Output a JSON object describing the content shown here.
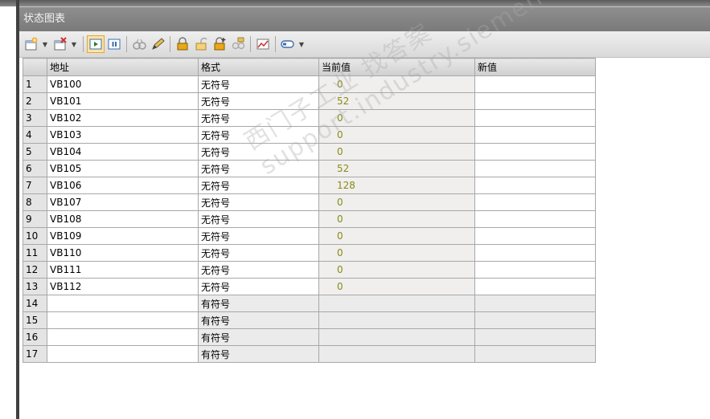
{
  "window": {
    "title": "状态图表"
  },
  "columns": {
    "num": "",
    "address": "地址",
    "format": "格式",
    "current": "当前值",
    "new": "新值"
  },
  "rows": [
    {
      "num": "1",
      "address": "VB100",
      "format": "无符号",
      "current": "0",
      "new": ""
    },
    {
      "num": "2",
      "address": "VB101",
      "format": "无符号",
      "current": "52",
      "new": ""
    },
    {
      "num": "3",
      "address": "VB102",
      "format": "无符号",
      "current": "0",
      "new": ""
    },
    {
      "num": "4",
      "address": "VB103",
      "format": "无符号",
      "current": "0",
      "new": ""
    },
    {
      "num": "5",
      "address": "VB104",
      "format": "无符号",
      "current": "0",
      "new": ""
    },
    {
      "num": "6",
      "address": "VB105",
      "format": "无符号",
      "current": "52",
      "new": ""
    },
    {
      "num": "7",
      "address": "VB106",
      "format": "无符号",
      "current": "128",
      "new": ""
    },
    {
      "num": "8",
      "address": "VB107",
      "format": "无符号",
      "current": "0",
      "new": ""
    },
    {
      "num": "9",
      "address": "VB108",
      "format": "无符号",
      "current": "0",
      "new": ""
    },
    {
      "num": "10",
      "address": "VB109",
      "format": "无符号",
      "current": "0",
      "new": ""
    },
    {
      "num": "11",
      "address": "VB110",
      "format": "无符号",
      "current": "0",
      "new": ""
    },
    {
      "num": "12",
      "address": "VB111",
      "format": "无符号",
      "current": "0",
      "new": ""
    },
    {
      "num": "13",
      "address": "VB112",
      "format": "无符号",
      "current": "0",
      "new": ""
    },
    {
      "num": "14",
      "address": "",
      "format": "有符号",
      "current": "",
      "new": ""
    },
    {
      "num": "15",
      "address": "",
      "format": "有符号",
      "current": "",
      "new": ""
    },
    {
      "num": "16",
      "address": "",
      "format": "有符号",
      "current": "",
      "new": ""
    },
    {
      "num": "17",
      "address": "",
      "format": "有符号",
      "current": "",
      "new": ""
    }
  ],
  "watermark": "西门子工业 找答案 support.industry.siemens.com/cs",
  "icons": {
    "toolbar": [
      "insert-row-icon",
      "delete-row-icon",
      "start-monitor-icon",
      "pause-monitor-icon",
      "read-icon",
      "write-icon",
      "force-icon",
      "unforce-icon",
      "unforce-all-icon",
      "read-forced-icon",
      "trend-view-icon",
      "tag-icon"
    ]
  },
  "colors": {
    "current_value_text": "#8a8a1a",
    "active_button_bg": "#fbe3a3"
  }
}
